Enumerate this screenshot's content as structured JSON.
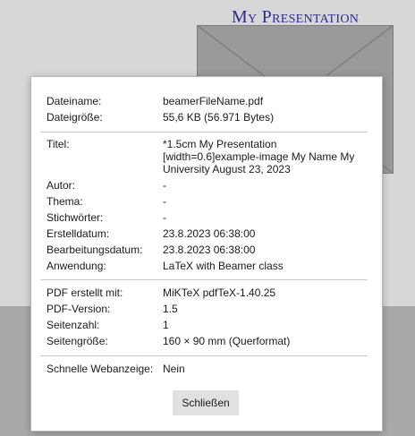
{
  "slide": {
    "title": "My Presentation"
  },
  "dialog": {
    "section_file": [
      {
        "key": "Dateiname:",
        "value": "beamerFileName.pdf"
      },
      {
        "key": "Dateigröße:",
        "value": "55,6 KB (56.971 Bytes)"
      }
    ],
    "section_meta": [
      {
        "key": "Titel:",
        "value": "*1.5cm My Presentation\n[width=0.6]example-image My Name My\nUniversity August 23, 2023"
      },
      {
        "key": "Autor:",
        "value": "-"
      },
      {
        "key": "Thema:",
        "value": "-"
      },
      {
        "key": "Stichwörter:",
        "value": "-"
      },
      {
        "key": "Erstelldatum:",
        "value": "23.8.2023 06:38:00"
      },
      {
        "key": "Bearbeitungsdatum:",
        "value": "23.8.2023 06:38:00"
      },
      {
        "key": "Anwendung:",
        "value": "LaTeX with Beamer class"
      }
    ],
    "section_pdf": [
      {
        "key": "PDF erstellt mit:",
        "value": "MiKTeX pdfTeX-1.40.25"
      },
      {
        "key": "PDF-Version:",
        "value": "1.5"
      },
      {
        "key": "Seitenzahl:",
        "value": "1"
      },
      {
        "key": "Seitengröße:",
        "value": "160 × 90 mm (Querformat)"
      }
    ],
    "section_web": [
      {
        "key": "Schnelle Webanzeige:",
        "value": "Nein"
      }
    ],
    "close_label": "Schließen"
  }
}
